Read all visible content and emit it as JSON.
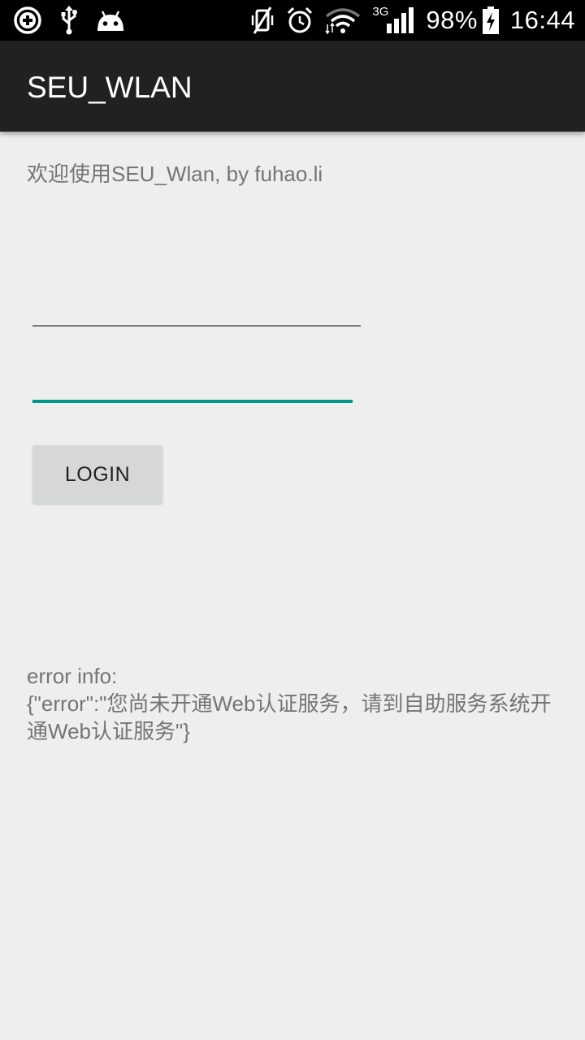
{
  "status_bar": {
    "icons_left": [
      "data-saver-icon",
      "usb-icon",
      "android-debug-icon"
    ],
    "icons_right": [
      "vibrate-off-icon",
      "alarm-icon",
      "wifi-icon",
      "signal-3g-icon"
    ],
    "network_label": "3G",
    "battery_text": "98%",
    "time": "16:44"
  },
  "app_bar": {
    "title": "SEU_WLAN"
  },
  "main": {
    "welcome": "欢迎使用SEU_Wlan, by fuhao.li",
    "username": {
      "value": "",
      "placeholder": ""
    },
    "password": {
      "value": "",
      "placeholder": ""
    },
    "login_label": "LOGIN",
    "error_label": "error info:",
    "error_message": "{\"error\":\"您尚未开通Web认证服务，请到自助服务系统开通Web认证服务\"}"
  },
  "colors": {
    "accent": "#009688",
    "app_bar": "#212121",
    "background": "#eeeeee"
  }
}
